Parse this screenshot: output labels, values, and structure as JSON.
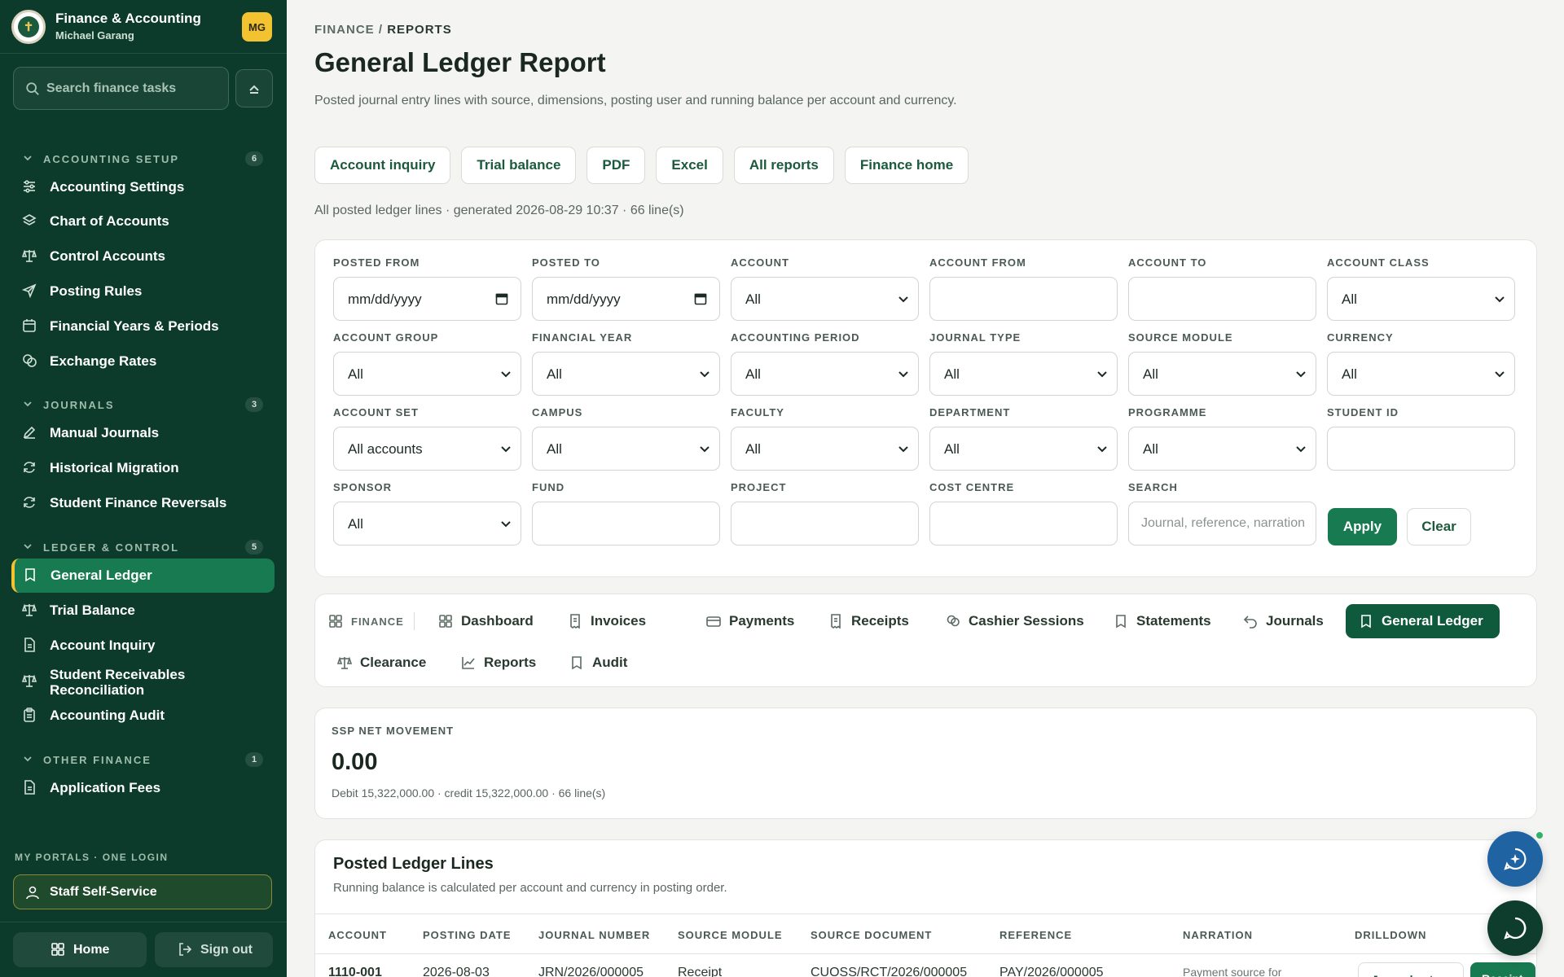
{
  "sidebar": {
    "brand_title": "Finance & Accounting",
    "user_name": "Michael Garang",
    "avatar_initials": "MG",
    "search_placeholder": "Search finance tasks",
    "sections": [
      {
        "label": "ACCOUNTING SETUP",
        "count": "6",
        "items": [
          "Accounting Settings",
          "Chart of Accounts",
          "Control Accounts",
          "Posting Rules",
          "Financial Years & Periods",
          "Exchange Rates"
        ]
      },
      {
        "label": "JOURNALS",
        "count": "3",
        "items": [
          "Manual Journals",
          "Historical Migration",
          "Student Finance Reversals"
        ]
      },
      {
        "label": "LEDGER & CONTROL",
        "count": "5",
        "items": [
          "General Ledger",
          "Trial Balance",
          "Account Inquiry",
          "Student Receivables Reconciliation",
          "Accounting Audit"
        ]
      },
      {
        "label": "OTHER FINANCE",
        "count": "1",
        "items": [
          "Application Fees"
        ]
      }
    ],
    "active_item": "General Ledger",
    "portals_label": "MY PORTALS · ONE LOGIN",
    "staff_self_service": "Staff Self-Service",
    "home_label": "Home",
    "signout_label": "Sign out"
  },
  "header": {
    "breadcrumb_root": "FINANCE",
    "breadcrumb_sep": "/",
    "breadcrumb_current": "REPORTS",
    "title": "General Ledger Report",
    "subtitle": "Posted journal entry lines with source, dimensions, posting user and running balance per account and currency.",
    "actions": [
      "Account inquiry",
      "Trial balance",
      "PDF",
      "Excel",
      "All reports",
      "Finance home"
    ],
    "generated_line": "All posted ledger lines · generated 2026-08-29 10:37 · 66 line(s)"
  },
  "filters": {
    "fields": [
      {
        "label": "POSTED FROM",
        "kind": "date",
        "value": "mm/dd/yyyy"
      },
      {
        "label": "POSTED TO",
        "kind": "date",
        "value": "mm/dd/yyyy"
      },
      {
        "label": "ACCOUNT",
        "kind": "select",
        "value": "All"
      },
      {
        "label": "ACCOUNT FROM",
        "kind": "text",
        "value": ""
      },
      {
        "label": "ACCOUNT TO",
        "kind": "text",
        "value": ""
      },
      {
        "label": "ACCOUNT CLASS",
        "kind": "select",
        "value": "All"
      },
      {
        "label": "ACCOUNT GROUP",
        "kind": "select",
        "value": "All"
      },
      {
        "label": "FINANCIAL YEAR",
        "kind": "select",
        "value": "All"
      },
      {
        "label": "ACCOUNTING PERIOD",
        "kind": "select",
        "value": "All"
      },
      {
        "label": "JOURNAL TYPE",
        "kind": "select",
        "value": "All"
      },
      {
        "label": "SOURCE MODULE",
        "kind": "select",
        "value": "All"
      },
      {
        "label": "CURRENCY",
        "kind": "select",
        "value": "All"
      },
      {
        "label": "ACCOUNT SET",
        "kind": "select",
        "value": "All accounts"
      },
      {
        "label": "CAMPUS",
        "kind": "select",
        "value": "All"
      },
      {
        "label": "FACULTY",
        "kind": "select",
        "value": "All"
      },
      {
        "label": "DEPARTMENT",
        "kind": "select",
        "value": "All"
      },
      {
        "label": "PROGRAMME",
        "kind": "select",
        "value": "All"
      },
      {
        "label": "STUDENT ID",
        "kind": "text",
        "value": ""
      },
      {
        "label": "SPONSOR",
        "kind": "select",
        "value": "All"
      },
      {
        "label": "FUND",
        "kind": "text",
        "value": ""
      },
      {
        "label": "PROJECT",
        "kind": "text",
        "value": ""
      },
      {
        "label": "COST CENTRE",
        "kind": "text",
        "value": ""
      },
      {
        "label": "SEARCH",
        "kind": "text",
        "value": "",
        "placeholder": "Journal, reference, narration"
      }
    ],
    "apply_label": "Apply",
    "clear_label": "Clear"
  },
  "module_nav": {
    "finance_label": "FINANCE",
    "items": [
      "Dashboard",
      "Invoices",
      "Payments",
      "Receipts",
      "Cashier Sessions",
      "Statements",
      "Journals",
      "General Ledger",
      "Clearance",
      "Reports",
      "Audit"
    ],
    "active": "General Ledger"
  },
  "kpi": {
    "label": "SSP NET MOVEMENT",
    "value": "0.00",
    "detail": "Debit 15,322,000.00 · credit 15,322,000.00 · 66 line(s)"
  },
  "ledger": {
    "title": "Posted Ledger Lines",
    "subtitle": "Running balance is calculated per account and currency in posting order.",
    "columns": [
      "ACCOUNT",
      "POSTING DATE",
      "JOURNAL NUMBER",
      "SOURCE MODULE",
      "SOURCE DOCUMENT",
      "REFERENCE",
      "NARRATION",
      "DRILLDOWN"
    ],
    "rows": [
      {
        "account": "1110-001",
        "posting_date": "2026-08-03",
        "journal_number": "JRN/2026/000005",
        "source_module": "Receipt",
        "source_document": "CUOSS/RCT/2026/000005",
        "reference": "PAY/2026/000005",
        "narration": "Payment source for",
        "drill1": "Journal entry",
        "drill2": "Receipt"
      }
    ]
  },
  "colors": {
    "sidebar_bg": "#0c3b2c",
    "accent": "#187a50",
    "highlight": "#f2c230",
    "chat_fab": "#1f63a3"
  }
}
